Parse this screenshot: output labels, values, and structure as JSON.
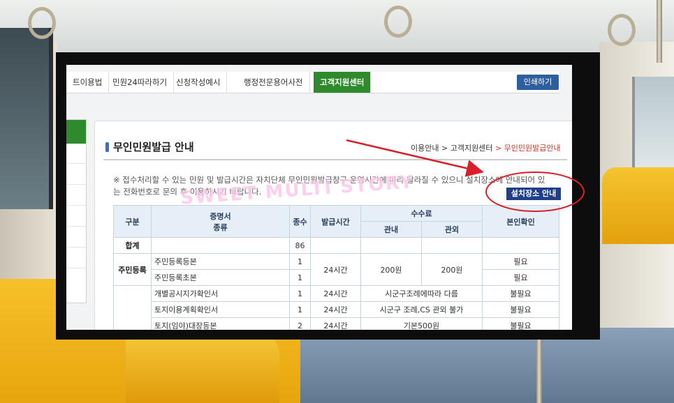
{
  "nav": {
    "tabs": [
      "트이용법",
      "민원24따라하기",
      "신청작성예시",
      "행정전문용어사전",
      "고객지원센터"
    ],
    "active_tab": "고객지원센터",
    "print_label": "인쇄하기"
  },
  "page": {
    "title": "무인민원발급 안내",
    "breadcrumb": [
      "이용안내",
      "고객지원센터",
      "무인민원발급안내"
    ],
    "crumb_sep": ">",
    "notice_line1": "※ 접수처리할 수 있는 민원 및 발급시간은 자치단체 무인민원발급창구 운영시간에 따라 달라질 수 있으니 설치장소에 안내되어 있",
    "notice_line2": "는 전화번호로 문의 후 이용하시기 바랍니다.",
    "location_button": "설치장소 안내"
  },
  "table": {
    "headers": {
      "category": "구분",
      "cert_type_1": "증명서",
      "cert_type_2": "종류",
      "count": "종수",
      "hours": "발급시간",
      "fee": "수수료",
      "fee_in": "관내",
      "fee_out": "관외",
      "id_check": "본인확인"
    },
    "total_label": "합계",
    "total_count": "86",
    "rows": [
      {
        "category": "주민등록",
        "name": "주민등록등본",
        "count": "1",
        "hours": "24시간",
        "fee_in": "200원",
        "fee_out": "200원",
        "id": "필요"
      },
      {
        "name": "주민등록초본",
        "count": "1",
        "id": "필요"
      },
      {
        "name": "개별공시지가확인서",
        "count": "1",
        "hours": "24시간",
        "fee_merged": "시군구조례에따라 다름",
        "id": "불필요"
      },
      {
        "name": "토지이용계획확인서",
        "count": "1",
        "hours": "24시간",
        "fee_merged": "시군구 조례,CS 관외 불가",
        "id": "불필요"
      },
      {
        "name": "토지(임야)대장등본",
        "count": "2",
        "hours": "24시간",
        "fee_merged": "기본500원",
        "id": "불필요"
      }
    ]
  },
  "overlay": {
    "watermark": "SWEET MULTI STORY",
    "arrow_color": "#d9202a"
  },
  "colors": {
    "nav_active": "#2e8a2a",
    "print_button": "#2d5e9e",
    "location_button": "#1f3f8a",
    "table_header": "#e6eef7",
    "breadcrumb_current": "#c0392b"
  }
}
